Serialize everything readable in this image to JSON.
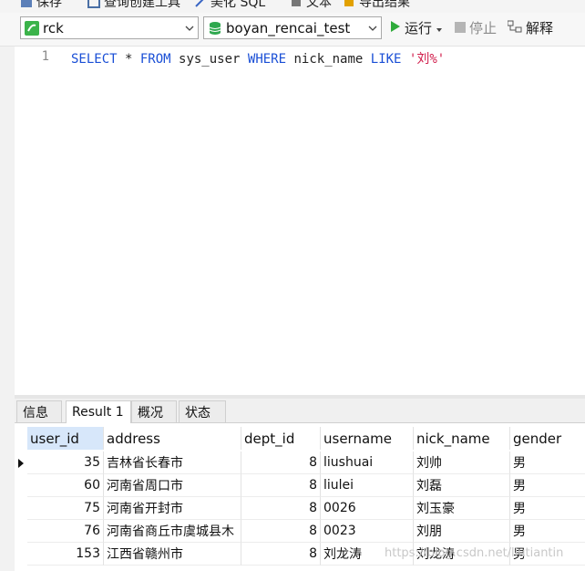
{
  "toolbar": {
    "items": [
      {
        "label": "保存",
        "icon": "save-icon"
      },
      {
        "label": "查询创建工具",
        "icon": "query-builder-icon"
      },
      {
        "label": "美化 SQL",
        "icon": "beautify-sql-icon"
      },
      {
        "label": "文本",
        "icon": "text-icon"
      },
      {
        "label": "导出结果",
        "icon": "export-icon"
      }
    ]
  },
  "connection": {
    "name": "rck",
    "database": "boyan_rencai_test",
    "run_label": "运行",
    "stop_label": "停止",
    "explain_label": "解释"
  },
  "editor": {
    "line_number": "1",
    "tokens": {
      "select": "SELECT",
      "star": " * ",
      "from": "FROM",
      "table": " sys_user ",
      "where": "WHERE",
      "column": " nick_name ",
      "like": "LIKE",
      "space": " ",
      "pattern": "'刘%'"
    }
  },
  "tabs": [
    {
      "label": "信息"
    },
    {
      "label": "Result 1"
    },
    {
      "label": "概况"
    },
    {
      "label": "状态"
    }
  ],
  "grid": {
    "columns": [
      "user_id",
      "address",
      "dept_id",
      "username",
      "nick_name",
      "gender"
    ],
    "rows": [
      [
        "35",
        "吉林省长春市",
        "8",
        "liushuai",
        "刘帅",
        "男"
      ],
      [
        "60",
        "河南省周口市",
        "8",
        "liulei",
        "刘磊",
        "男"
      ],
      [
        "75",
        "河南省开封市",
        "8",
        "0026",
        "刘玉豪",
        "男"
      ],
      [
        "76",
        "河南省商丘市虞城县木",
        "8",
        "0023",
        "刘朋",
        "男"
      ],
      [
        "153",
        "江西省赣州市",
        "8",
        "刘龙涛",
        "刘龙涛",
        "男"
      ]
    ]
  },
  "watermark": "https://blog.csdn.net/liutiantin",
  "colors": {
    "keyword": "#1a4fd6",
    "string": "#d11d4b",
    "run_green": "#2eaa3a",
    "selected_header": "#d7e7fa"
  }
}
